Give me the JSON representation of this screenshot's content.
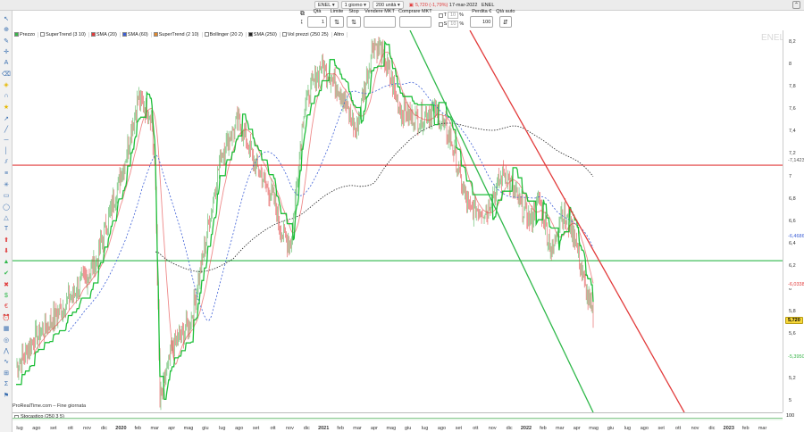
{
  "toolbar": {
    "symbol": "ENEL",
    "timeframe": "1 giorno",
    "units": "200 unità",
    "price_info": "5,720 (-1,79%)",
    "date": "17-mar-2022",
    "name": "ENEL"
  },
  "order": {
    "qty_label": "Qtà",
    "qty_value": "1",
    "limit_label": "Limite",
    "stop_label": "Stop",
    "sell_label": "Vendere MKT",
    "buy_label": "Comprare MKT",
    "t_label": "T",
    "s_label": "S",
    "t_pct": "10",
    "s_pct": "10",
    "pct_sign": "%",
    "loss_label": "Perdita €",
    "loss_value": "100",
    "qty_auto_label": "Qtà auto"
  },
  "legend": [
    {
      "label": "Prezzo",
      "color": "#39b54a",
      "checked": true
    },
    {
      "label": "SuperTrend (3 10)",
      "color": "#ffffff",
      "checked": false
    },
    {
      "label": "SMA (20)",
      "color": "#e23b3b",
      "checked": true
    },
    {
      "label": "SMA (60)",
      "color": "#3d5fd6",
      "checked": true
    },
    {
      "label": "SuperTrend (2 10)",
      "color": "#e38a2e",
      "checked": true
    },
    {
      "label": "Bollinger (20 2)",
      "color": "#ffffff",
      "checked": false
    },
    {
      "label": "SMA (250)",
      "color": "#222222",
      "checked": true
    },
    {
      "label": "Vol prezzi (250 25)",
      "color": "#ffffff",
      "checked": false
    },
    {
      "label": "Altro",
      "color": "",
      "checked": false
    }
  ],
  "watermark": "ENEL",
  "y_ticks": [
    "8,2",
    "8",
    "7,8",
    "7,6",
    "7,4",
    "7,2",
    "7",
    "6,8",
    "6,6",
    "6,4",
    "6,2",
    "6",
    "5,8",
    "5,6",
    "5,4",
    "5,2",
    "5"
  ],
  "y_tags": [
    {
      "text": "-7,1423",
      "color": "#555555"
    },
    {
      "text": "-6,4686",
      "color": "#3d5fd6"
    },
    {
      "text": "-6,0338",
      "color": "#e23b3b"
    },
    {
      "text": "5,720",
      "color": "#000000",
      "highlight": "#f7d73a"
    },
    {
      "text": "-5,3950",
      "color": "#39b54a"
    }
  ],
  "footer": {
    "source": "ProRealTime.com – Fine giornata",
    "indicator": "Stocastico (250 3 5)",
    "indicator_value": "100"
  },
  "x_labels": [
    {
      "text": "lug",
      "year": false
    },
    {
      "text": "ago",
      "year": false
    },
    {
      "text": "set",
      "year": false
    },
    {
      "text": "ott",
      "year": false
    },
    {
      "text": "nov",
      "year": false
    },
    {
      "text": "dic",
      "year": false
    },
    {
      "text": "2020",
      "year": true
    },
    {
      "text": "feb",
      "year": false
    },
    {
      "text": "mar",
      "year": false
    },
    {
      "text": "apr",
      "year": false
    },
    {
      "text": "mag",
      "year": false
    },
    {
      "text": "giu",
      "year": false
    },
    {
      "text": "lug",
      "year": false
    },
    {
      "text": "ago",
      "year": false
    },
    {
      "text": "set",
      "year": false
    },
    {
      "text": "ott",
      "year": false
    },
    {
      "text": "nov",
      "year": false
    },
    {
      "text": "dic",
      "year": false
    },
    {
      "text": "2021",
      "year": true
    },
    {
      "text": "feb",
      "year": false
    },
    {
      "text": "mar",
      "year": false
    },
    {
      "text": "apr",
      "year": false
    },
    {
      "text": "mag",
      "year": false
    },
    {
      "text": "giu",
      "year": false
    },
    {
      "text": "lug",
      "year": false
    },
    {
      "text": "ago",
      "year": false
    },
    {
      "text": "set",
      "year": false
    },
    {
      "text": "ott",
      "year": false
    },
    {
      "text": "nov",
      "year": false
    },
    {
      "text": "dic",
      "year": false
    },
    {
      "text": "2022",
      "year": true
    },
    {
      "text": "feb",
      "year": false
    },
    {
      "text": "mar",
      "year": false
    },
    {
      "text": "apr",
      "year": false
    },
    {
      "text": "mag",
      "year": false
    },
    {
      "text": "giu",
      "year": false
    },
    {
      "text": "lug",
      "year": false
    },
    {
      "text": "ago",
      "year": false
    },
    {
      "text": "set",
      "year": false
    },
    {
      "text": "ott",
      "year": false
    },
    {
      "text": "nov",
      "year": false
    },
    {
      "text": "dic",
      "year": false
    },
    {
      "text": "2023",
      "year": true
    },
    {
      "text": "feb",
      "year": false
    },
    {
      "text": "mar",
      "year": false
    }
  ],
  "colors": {
    "up": "#3fae49",
    "down": "#e03c3c",
    "sma20": "#e23b3b",
    "sma60": "#3d5fd6",
    "sma250": "#222222",
    "supertrend": "#1fbf3a",
    "hline_red": "#e23b3b",
    "hline_green": "#2fb84a"
  },
  "tools": [
    "cursor-icon",
    "zoom-icon",
    "pencil-icon",
    "crosshair-icon",
    "text-icon",
    "eraser-icon",
    "bucket-icon",
    "magnet-icon",
    "star-icon",
    "arrow-icon",
    "line-icon",
    "hline-icon",
    "vline-icon",
    "channel-icon",
    "fib-icon",
    "gann-icon",
    "rect-icon",
    "ellipse-icon",
    "triangle-icon",
    "text-tool-icon",
    "up-arrow-icon",
    "down-arrow-icon",
    "up-green-icon",
    "check-icon",
    "x-icon",
    "buy-icon",
    "sell-icon",
    "alert-icon",
    "stat-icon",
    "target-icon",
    "zigzag-icon",
    "wave-icon",
    "grid-icon",
    "sum-icon",
    "flag-icon"
  ]
}
